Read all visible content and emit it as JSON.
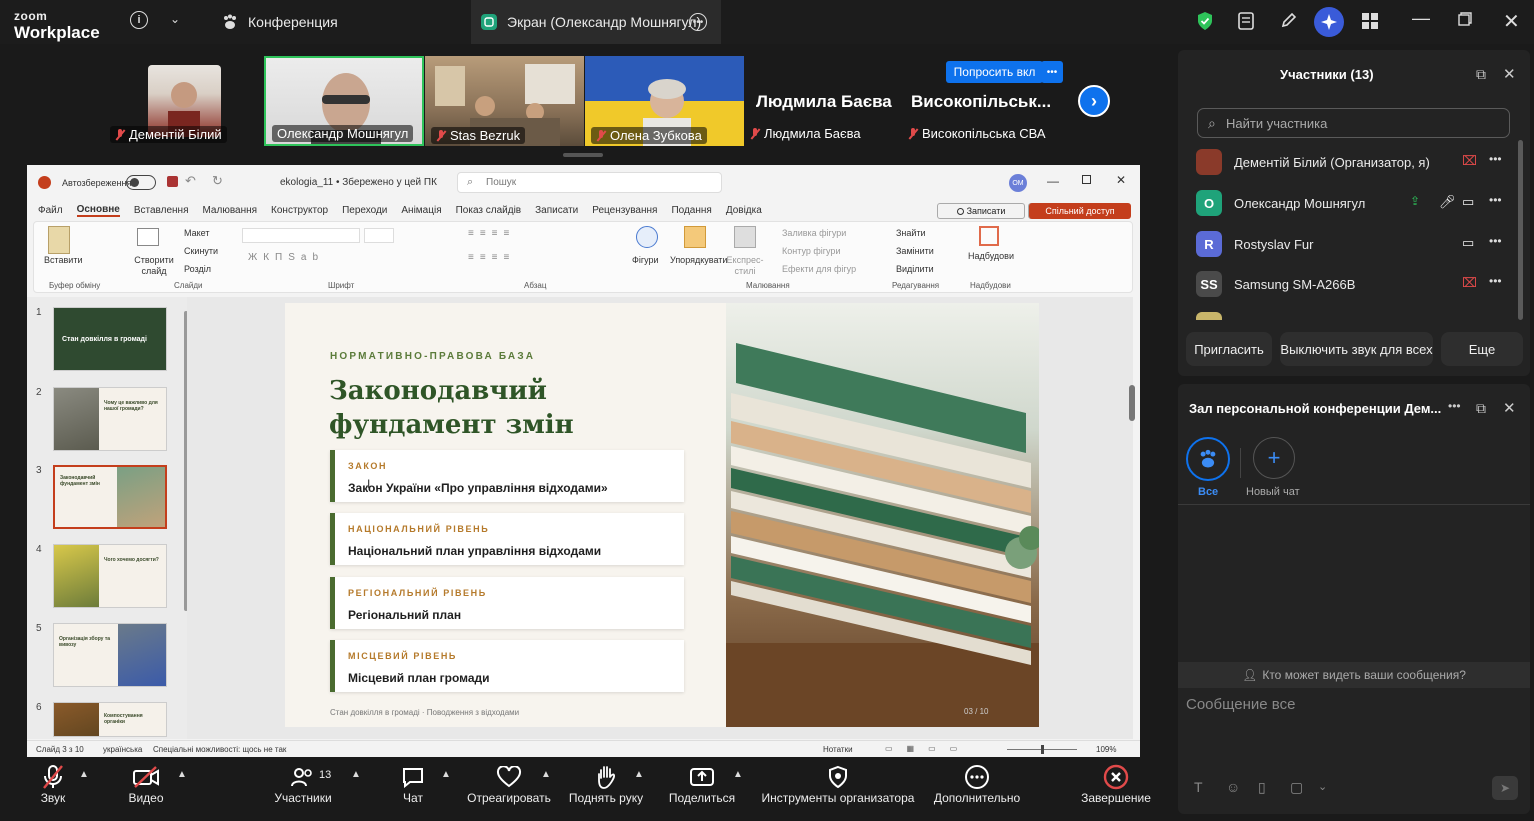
{
  "app": {
    "logo_top": "zoom",
    "logo_bottom": "Workplace"
  },
  "topbar": {
    "conference_tab": "Конференция",
    "screen_tab": "Экран (Олександр Мошнягул)"
  },
  "video_strip": {
    "ask_button": "Попросить вкл",
    "tiles": [
      {
        "name": "Дементій Білий"
      },
      {
        "name": "Олександр Мошнягул"
      },
      {
        "name": "Stas Bezruk"
      },
      {
        "name": "Олена Зубкова"
      },
      {
        "name": "Людмила Баєва",
        "big": "Людмила Баєва"
      },
      {
        "name": "Високопільська СВА",
        "big": "Високопільськ..."
      }
    ]
  },
  "ppt": {
    "autosave": "Автозбереження",
    "filename": "ekologia_11 • Збережено у цей ПК",
    "search": "Пошук",
    "user_initials": "ОМ",
    "tabs": [
      "Файл",
      "Основне",
      "Вставлення",
      "Малювання",
      "Конструктор",
      "Переходи",
      "Анімація",
      "Показ слайдів",
      "Записати",
      "Рецензування",
      "Подання",
      "Довідка"
    ],
    "record_btn": "Записати",
    "share_btn": "Спільний доступ",
    "ribbon": {
      "paste": "Вставити",
      "new_slide": "Створити слайд",
      "layout": "Макет",
      "reset": "Скинути",
      "section": "Розділ",
      "shapes": "Фігури",
      "arrange": "Упорядкувати",
      "quick_styles": "Експрес-стилі",
      "shape_fill": "Заливка фігури",
      "shape_outline": "Контур фігури",
      "shape_effects": "Ефекти для фігур",
      "find": "Знайти",
      "replace": "Замінити",
      "select": "Виділити",
      "addins": "Надбудови",
      "groups": [
        "Буфер обміну",
        "Слайди",
        "Шрифт",
        "Абзац",
        "Малювання",
        "Редагування",
        "Надбудови"
      ]
    },
    "slide_numbers": [
      "1",
      "2",
      "3",
      "4",
      "5",
      "6"
    ],
    "thumb_texts": [
      "Стан довкілля в громаді",
      "Чому це важливо для нашої громади?",
      "Законодавчий фундамент змін",
      "Чого хочемо досягти?",
      "Організація збору та вивозу",
      "Компостування органіки"
    ],
    "slide": {
      "eyebrow": "НОРМАТИВНО-ПРАВОВА БАЗА",
      "title_line1": "Законодавчий",
      "title_line2": "фундамент змін",
      "cards": [
        {
          "k": "ЗАКОН",
          "v": "Закон України «Про управління відходами»"
        },
        {
          "k": "НАЦІОНАЛЬНИЙ РІВЕНЬ",
          "v": "Національний план управління відходами"
        },
        {
          "k": "РЕГІОНАЛЬНИЙ РІВЕНЬ",
          "v": "Регіональний план"
        },
        {
          "k": "МІСЦЕВИЙ РІВЕНЬ",
          "v": "Місцевий план громади"
        }
      ],
      "footer": "Стан довкілля в громаді · Поводження з відходами",
      "page": "03 / 10"
    },
    "status": {
      "slide": "Слайд 3 з 10",
      "lang": "українська",
      "access": "Спеціальні можливості: щось не так",
      "notes": "Нотатки",
      "zoom": "109%"
    }
  },
  "participants": {
    "title": "Участники (13)",
    "search_placeholder": "Найти участника",
    "list": [
      {
        "name": "Дементій Білий (Организатор, я)",
        "initial": "",
        "color": "#8a3a2a"
      },
      {
        "name": "Олександр Мошнягул",
        "initial": "О",
        "color": "#1fa37a"
      },
      {
        "name": "Rostyslav Fur",
        "initial": "R",
        "color": "#5b6bd6"
      },
      {
        "name": "Samsung SM-A266B",
        "initial": "SS",
        "color": "#4a4a4a"
      }
    ],
    "invite": "Пригласить",
    "mute_all": "Выключить звук для всех",
    "more": "Еще"
  },
  "chat": {
    "title": "Зал персональной конференции Дем...",
    "all_label": "Все",
    "new_chat": "Новый чат",
    "who_can_see": "Кто может видеть ваши сообщения?",
    "placeholder": "Сообщение все"
  },
  "bottombar": {
    "audio": "Звук",
    "video": "Видео",
    "participants": "Участники",
    "participants_count": "13",
    "chat": "Чат",
    "react": "Отреагировать",
    "raise_hand": "Поднять руку",
    "share": "Поделиться",
    "host_tools": "Инструменты организатора",
    "more": "Дополнительно",
    "end": "Завершение"
  }
}
